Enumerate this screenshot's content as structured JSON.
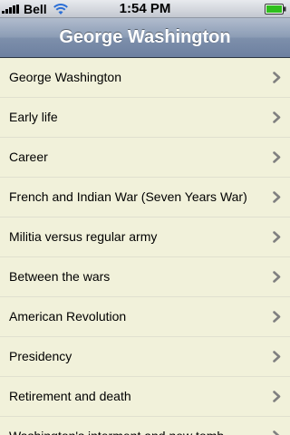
{
  "status_bar": {
    "carrier": "Bell",
    "time": "1:54 PM",
    "signal_icon": "signal-bars-icon",
    "wifi_icon": "wifi-icon",
    "battery_icon": "battery-icon",
    "battery_level": 1.0,
    "battery_color": "#2fbf1d"
  },
  "nav_bar": {
    "title": "George Washington"
  },
  "list": {
    "items": [
      {
        "label": "George Washington"
      },
      {
        "label": "Early life"
      },
      {
        "label": "Career"
      },
      {
        "label": "French and Indian War (Seven Years War)"
      },
      {
        "label": "Militia versus regular army"
      },
      {
        "label": "Between the wars"
      },
      {
        "label": "American Revolution"
      },
      {
        "label": "Presidency"
      },
      {
        "label": "Retirement and death"
      },
      {
        "label": "Washington's interment and new tomb"
      }
    ],
    "disclosure_icon": "chevron-right-icon"
  },
  "colors": {
    "list_background": "#f1f1da",
    "separator": "#e0e0cf",
    "nav_bar": "#8c9db6",
    "chevron": "#808080"
  }
}
